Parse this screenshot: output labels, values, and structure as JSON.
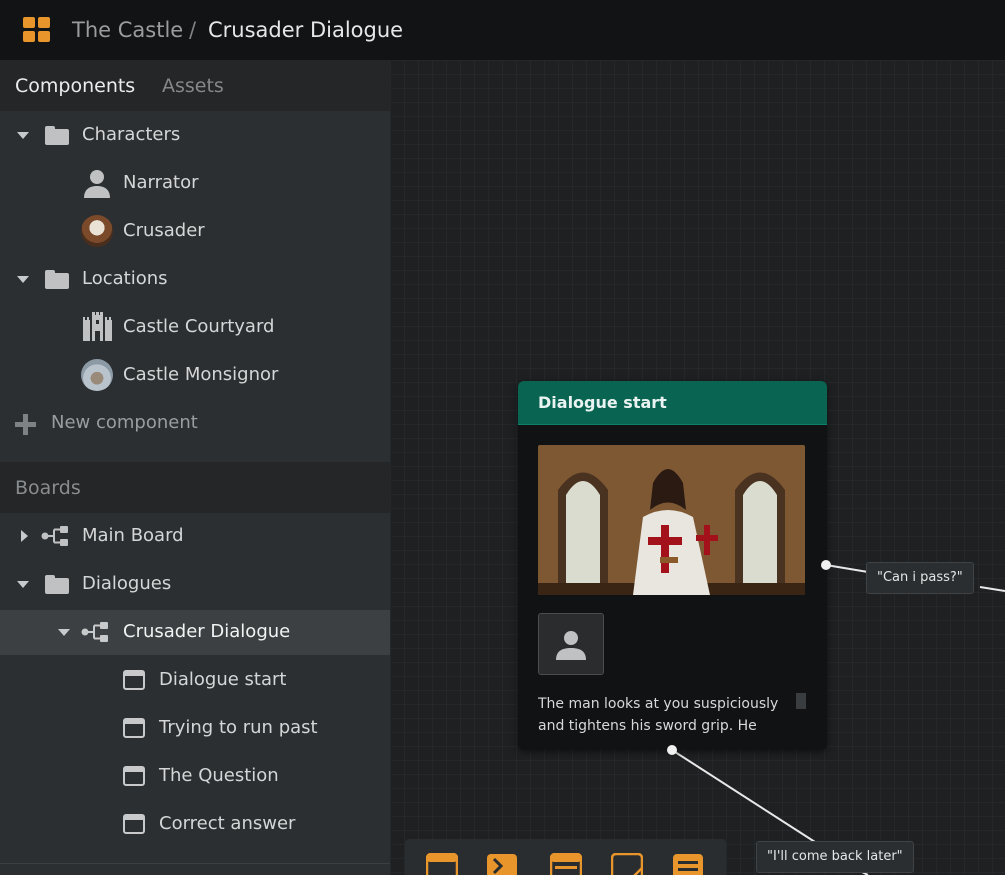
{
  "breadcrumb": {
    "parent": "The Castle",
    "separator": "/",
    "current": "Crusader Dialogue"
  },
  "sidebar": {
    "tabs": [
      "Components",
      "Assets"
    ],
    "components": [
      {
        "label": "Characters",
        "type": "folder",
        "expanded": true,
        "icon": "folder-icon"
      },
      {
        "label": "Narrator",
        "type": "character",
        "icon": "person-icon"
      },
      {
        "label": "Crusader",
        "type": "character",
        "icon": "crusader-avatar"
      },
      {
        "label": "Locations",
        "type": "folder",
        "expanded": true,
        "icon": "folder-icon"
      },
      {
        "label": "Castle Courtyard",
        "type": "location",
        "icon": "castle-icon"
      },
      {
        "label": "Castle Monsignor",
        "type": "location",
        "icon": "castle-monsignor-avatar"
      }
    ],
    "new_component": "New component",
    "boards_header": "Boards",
    "boards": [
      {
        "label": "Main Board",
        "type": "board",
        "expanded": false,
        "icon": "board-icon"
      },
      {
        "label": "Dialogues",
        "type": "folder",
        "expanded": true,
        "icon": "folder-icon"
      },
      {
        "label": "Crusader Dialogue",
        "type": "board",
        "expanded": true,
        "selected": true,
        "icon": "board-icon"
      },
      {
        "label": "Dialogue start",
        "type": "node",
        "icon": "card-icon"
      },
      {
        "label": "Trying to run past",
        "type": "node",
        "icon": "card-icon"
      },
      {
        "label": "The Question",
        "type": "node",
        "icon": "card-icon"
      },
      {
        "label": "Correct answer",
        "type": "node",
        "icon": "card-icon"
      }
    ]
  },
  "canvas": {
    "node": {
      "title": "Dialogue start",
      "text": "The man looks at you suspiciously and tightens his sword grip. He"
    },
    "choices": [
      "\"Can i pass?\"",
      "\"I'll come back later\""
    ],
    "toolbar_icons": [
      "card-icon",
      "branch-icon",
      "list-card-icon",
      "note-icon",
      "list-icon"
    ]
  },
  "colors": {
    "accent": "#e8952b",
    "node_header": "#0a6452",
    "topbar": "#121314",
    "sidebar": "#2c2f31",
    "canvas": "#1e2022"
  }
}
